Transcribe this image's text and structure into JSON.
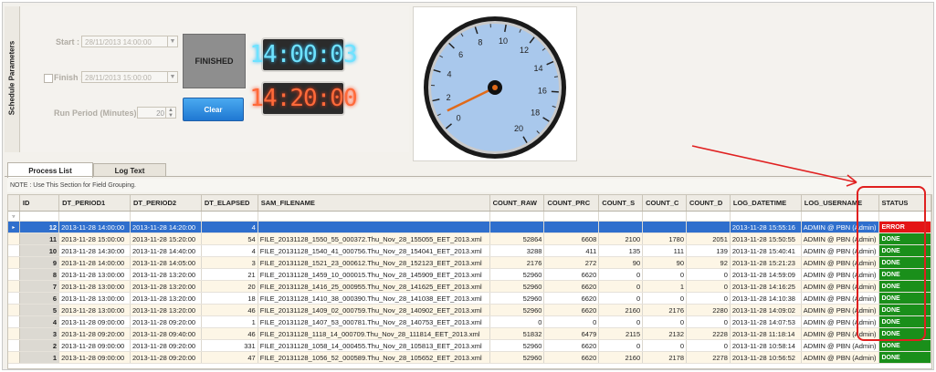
{
  "side_tab": {
    "label": "Schedule Parameters"
  },
  "params": {
    "start_label": "Start :",
    "start_value": "28/11/2013 14:00:00",
    "finish_label": "Finish :",
    "finish_value": "28/11/2013 15:00:00",
    "run_period_label": "Run Period (Minutes) :",
    "run_period_value": "20"
  },
  "status_box": {
    "label": "FINISHED"
  },
  "clear_button": {
    "label": "Clear"
  },
  "clock_current": "14:00:03",
  "clock_target": "14:20:00",
  "gauge": {
    "ticks": [
      "0",
      "2",
      "4",
      "6",
      "8",
      "10",
      "12",
      "14",
      "16",
      "18",
      "20"
    ],
    "value": 0.05
  },
  "tabs": [
    {
      "label": "Process List"
    },
    {
      "label": "Log Text"
    }
  ],
  "note": "NOTE : Use This Section for Field Grouping.",
  "table": {
    "columns": [
      "ID",
      "DT_PERIOD1",
      "DT_PERIOD2",
      "DT_ELAPSED",
      "SAM_FILENAME",
      "COUNT_RAW",
      "COUNT_PRC",
      "COUNT_S",
      "COUNT_C",
      "COUNT_D",
      "LOG_DATETIME",
      "LOG_USERNAME",
      "STATUS"
    ],
    "rows": [
      [
        "12",
        "2013-11-28 14:00:00",
        "2013-11-28 14:20:00",
        "4",
        "",
        "",
        "",
        "",
        "",
        "",
        "2013-11-28 15:55:16",
        "ADMIN @ PBN (Admin)",
        "ERROR"
      ],
      [
        "11",
        "2013-11-28 15:00:00",
        "2013-11-28 15:20:00",
        "54",
        "FILE_20131128_1550_55_000372.Thu_Nov_28_155055_EET_2013.xml",
        "52864",
        "6608",
        "2100",
        "1780",
        "2051",
        "2013-11-28 15:50:55",
        "ADMIN @ PBN (Admin)",
        "DONE"
      ],
      [
        "10",
        "2013-11-28 14:30:00",
        "2013-11-28 14:40:00",
        "4",
        "FILE_20131128_1540_41_000756.Thu_Nov_28_154041_EET_2013.xml",
        "3288",
        "411",
        "135",
        "111",
        "139",
        "2013-11-28 15:40:41",
        "ADMIN @ PBN (Admin)",
        "DONE"
      ],
      [
        "9",
        "2013-11-28 14:00:00",
        "2013-11-28 14:05:00",
        "3",
        "FILE_20131128_1521_23_000612.Thu_Nov_28_152123_EET_2013.xml",
        "2176",
        "272",
        "90",
        "90",
        "92",
        "2013-11-28 15:21:23",
        "ADMIN @ PBN (Admin)",
        "DONE"
      ],
      [
        "8",
        "2013-11-28 13:00:00",
        "2013-11-28 13:20:00",
        "21",
        "FILE_20131128_1459_10_000015.Thu_Nov_28_145909_EET_2013.xml",
        "52960",
        "6620",
        "0",
        "0",
        "0",
        "2013-11-28 14:59:09",
        "ADMIN @ PBN (Admin)",
        "DONE"
      ],
      [
        "7",
        "2013-11-28 13:00:00",
        "2013-11-28 13:20:00",
        "20",
        "FILE_20131128_1416_25_000955.Thu_Nov_28_141625_EET_2013.xml",
        "52960",
        "6620",
        "0",
        "1",
        "0",
        "2013-11-28 14:16:25",
        "ADMIN @ PBN (Admin)",
        "DONE"
      ],
      [
        "6",
        "2013-11-28 13:00:00",
        "2013-11-28 13:20:00",
        "18",
        "FILE_20131128_1410_38_000390.Thu_Nov_28_141038_EET_2013.xml",
        "52960",
        "6620",
        "0",
        "0",
        "0",
        "2013-11-28 14:10:38",
        "ADMIN @ PBN (Admin)",
        "DONE"
      ],
      [
        "5",
        "2013-11-28 13:00:00",
        "2013-11-28 13:20:00",
        "46",
        "FILE_20131128_1409_02_000759.Thu_Nov_28_140902_EET_2013.xml",
        "52960",
        "6620",
        "2160",
        "2176",
        "2280",
        "2013-11-28 14:09:02",
        "ADMIN @ PBN (Admin)",
        "DONE"
      ],
      [
        "4",
        "2013-11-28 09:00:00",
        "2013-11-28 09:20:00",
        "1",
        "FILE_20131128_1407_53_000781.Thu_Nov_28_140753_EET_2013.xml",
        "0",
        "0",
        "0",
        "0",
        "0",
        "2013-11-28 14:07:53",
        "ADMIN @ PBN (Admin)",
        "DONE"
      ],
      [
        "3",
        "2013-11-28 09:20:00",
        "2013-11-28 09:40:00",
        "46",
        "FILE_20131128_1118_14_000709.Thu_Nov_28_111814_EET_2013.xml",
        "51832",
        "6479",
        "2115",
        "2132",
        "2228",
        "2013-11-28 11:18:14",
        "ADMIN @ PBN (Admin)",
        "DONE"
      ],
      [
        "2",
        "2013-11-28 09:00:00",
        "2013-11-28 09:20:00",
        "331",
        "FILE_20131128_1058_14_000455.Thu_Nov_28_105813_EET_2013.xml",
        "52960",
        "6620",
        "0",
        "0",
        "0",
        "2013-11-28 10:58:14",
        "ADMIN @ PBN (Admin)",
        "DONE"
      ],
      [
        "1",
        "2013-11-28 09:00:00",
        "2013-11-28 09:20:00",
        "47",
        "FILE_20131128_1056_52_000589.Thu_Nov_28_105652_EET_2013.xml",
        "52960",
        "6620",
        "2160",
        "2178",
        "2278",
        "2013-11-28 10:56:52",
        "ADMIN @ PBN (Admin)",
        "DONE"
      ]
    ]
  },
  "colors": {
    "done": "#1a8f1a",
    "error": "#e41515",
    "selected": "#2f6fcd",
    "annotation": "#e02020"
  }
}
